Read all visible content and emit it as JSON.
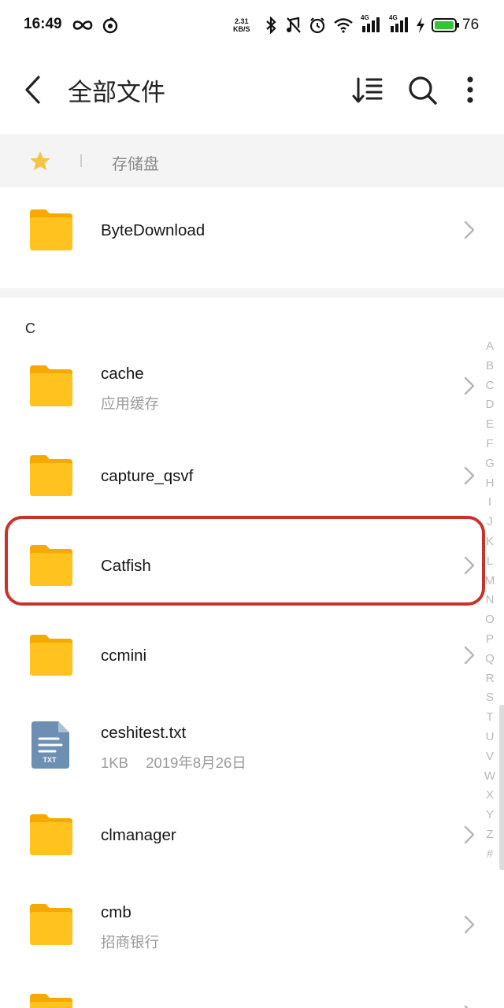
{
  "status_bar": {
    "time": "16:49",
    "net_speed_value": "2.31",
    "net_speed_unit": "KB/S",
    "signal1": "4G",
    "signal2": "4G",
    "battery": "76"
  },
  "header": {
    "title": "全部文件",
    "icons": [
      "back-icon",
      "sort-icon",
      "search-icon",
      "more-icon"
    ]
  },
  "breadcrumb": {
    "label": "存储盘"
  },
  "pinned": [
    {
      "name": "ByteDownload",
      "icon": "folder-icon"
    }
  ],
  "section_header": "C",
  "files": [
    {
      "name": "cache",
      "sub": "应用缓存",
      "icon": "folder-icon"
    },
    {
      "name": "capture_qsvf",
      "sub": "",
      "icon": "folder-icon"
    },
    {
      "name": "Catfish",
      "sub": "",
      "icon": "folder-icon",
      "highlighted": true
    },
    {
      "name": "ccmini",
      "sub": "",
      "icon": "folder-icon"
    },
    {
      "name": "ceshitest.txt",
      "size": "1KB",
      "date": "2019年8月26日",
      "icon": "txt-file-icon",
      "badge": "TXT"
    },
    {
      "name": "clmanager",
      "sub": "",
      "icon": "folder-icon"
    },
    {
      "name": "cmb",
      "sub": "招商银行",
      "icon": "folder-icon"
    }
  ],
  "alphabet_index": [
    "A",
    "B",
    "C",
    "D",
    "E",
    "F",
    "G",
    "H",
    "I",
    "J",
    "K",
    "L",
    "M",
    "N",
    "O",
    "P",
    "Q",
    "R",
    "S",
    "T",
    "U",
    "V",
    "W",
    "X",
    "Y",
    "Z",
    "#"
  ],
  "colors": {
    "folder": "#ffbf1a",
    "folder_tab": "#f5a800",
    "star": "#f6c445",
    "highlight_border": "#c8322b",
    "txt_icon": "#6d8fb3",
    "battery_fill": "#35c435"
  }
}
